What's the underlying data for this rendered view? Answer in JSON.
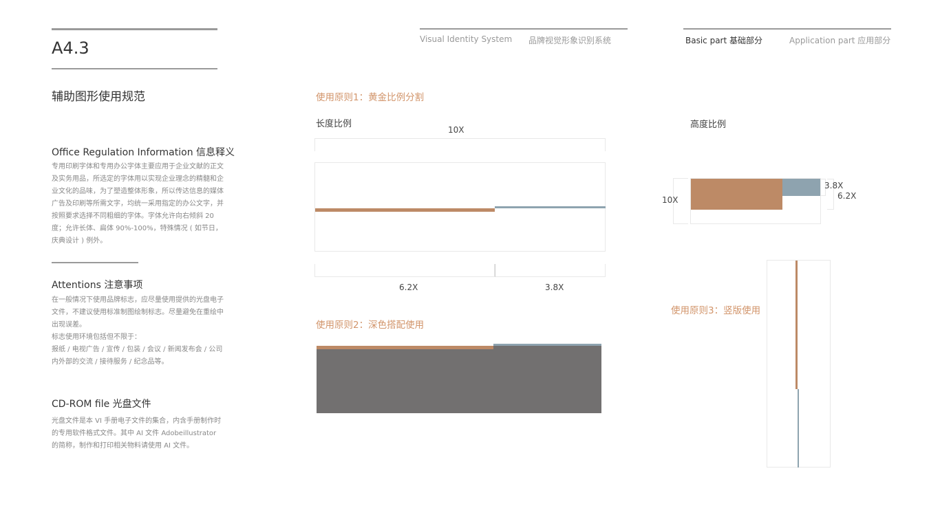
{
  "page_number": "A4.3",
  "header": {
    "vis_en": "Visual Identity System",
    "vis_cn": "品牌视觉形象识别系统",
    "basic": "Basic part  基础部分",
    "application": "Application part  应用部分"
  },
  "left": {
    "title": "辅助图形使用规范",
    "sections": [
      {
        "heading": "Office Regulation Information 信息释义",
        "body": "专用印刷字体和专用办公字体主要应用于企业文献的正文及实务用品，所选定的字体用以实现企业理念的精髓和企业文化的品味，为了塑造整体形象，所以传达信息的媒体广告及印刷等所需文字，均统一采用指定的办公文字，并按照要求选择不同粗细的字体。字体允许向右倾斜 20 度；允许长体、扁体 90%-100%，特殊情况 ( 如节日，庆典设计 ) 例外。"
      },
      {
        "heading": "Attentions 注意事项",
        "body": "在一般情况下使用品牌标志，应尽量使用提供的光盘电子文件，不建议使用标准制图绘制标志。尽量避免在重绘中出现误差。",
        "body2": "标志使用环境包括但不限于：",
        "body3": "报纸 / 电视广告 / 宣传 / 包装 / 会议 / 新闻发布会 / 公司内外部的交流 / 接待服务 / 纪念品等。"
      },
      {
        "heading": "CD-ROM file 光盘文件",
        "body": "光盘文件是本 VI 手册电子文件的集合，内含手册制作时的专用软件格式文件。其中 AI 文件 Adobeillustrator 的简称，制作和打印相关物料请使用 AI 文件。"
      }
    ]
  },
  "main": {
    "principle1": "使用原则1：黄金比例分割",
    "length_ratio": "长度比例",
    "height_ratio": "高度比例",
    "total": "10X",
    "part_a": "6.2X",
    "part_b": "3.8X",
    "principle2": "使用原则2：深色搭配使用",
    "principle3": "使用原则3：竖版使用"
  },
  "colors": {
    "brown": "#bd8a66",
    "blue_gray": "#8ea3af",
    "dark_gray": "#727070",
    "accent_text": "#d2956b"
  }
}
